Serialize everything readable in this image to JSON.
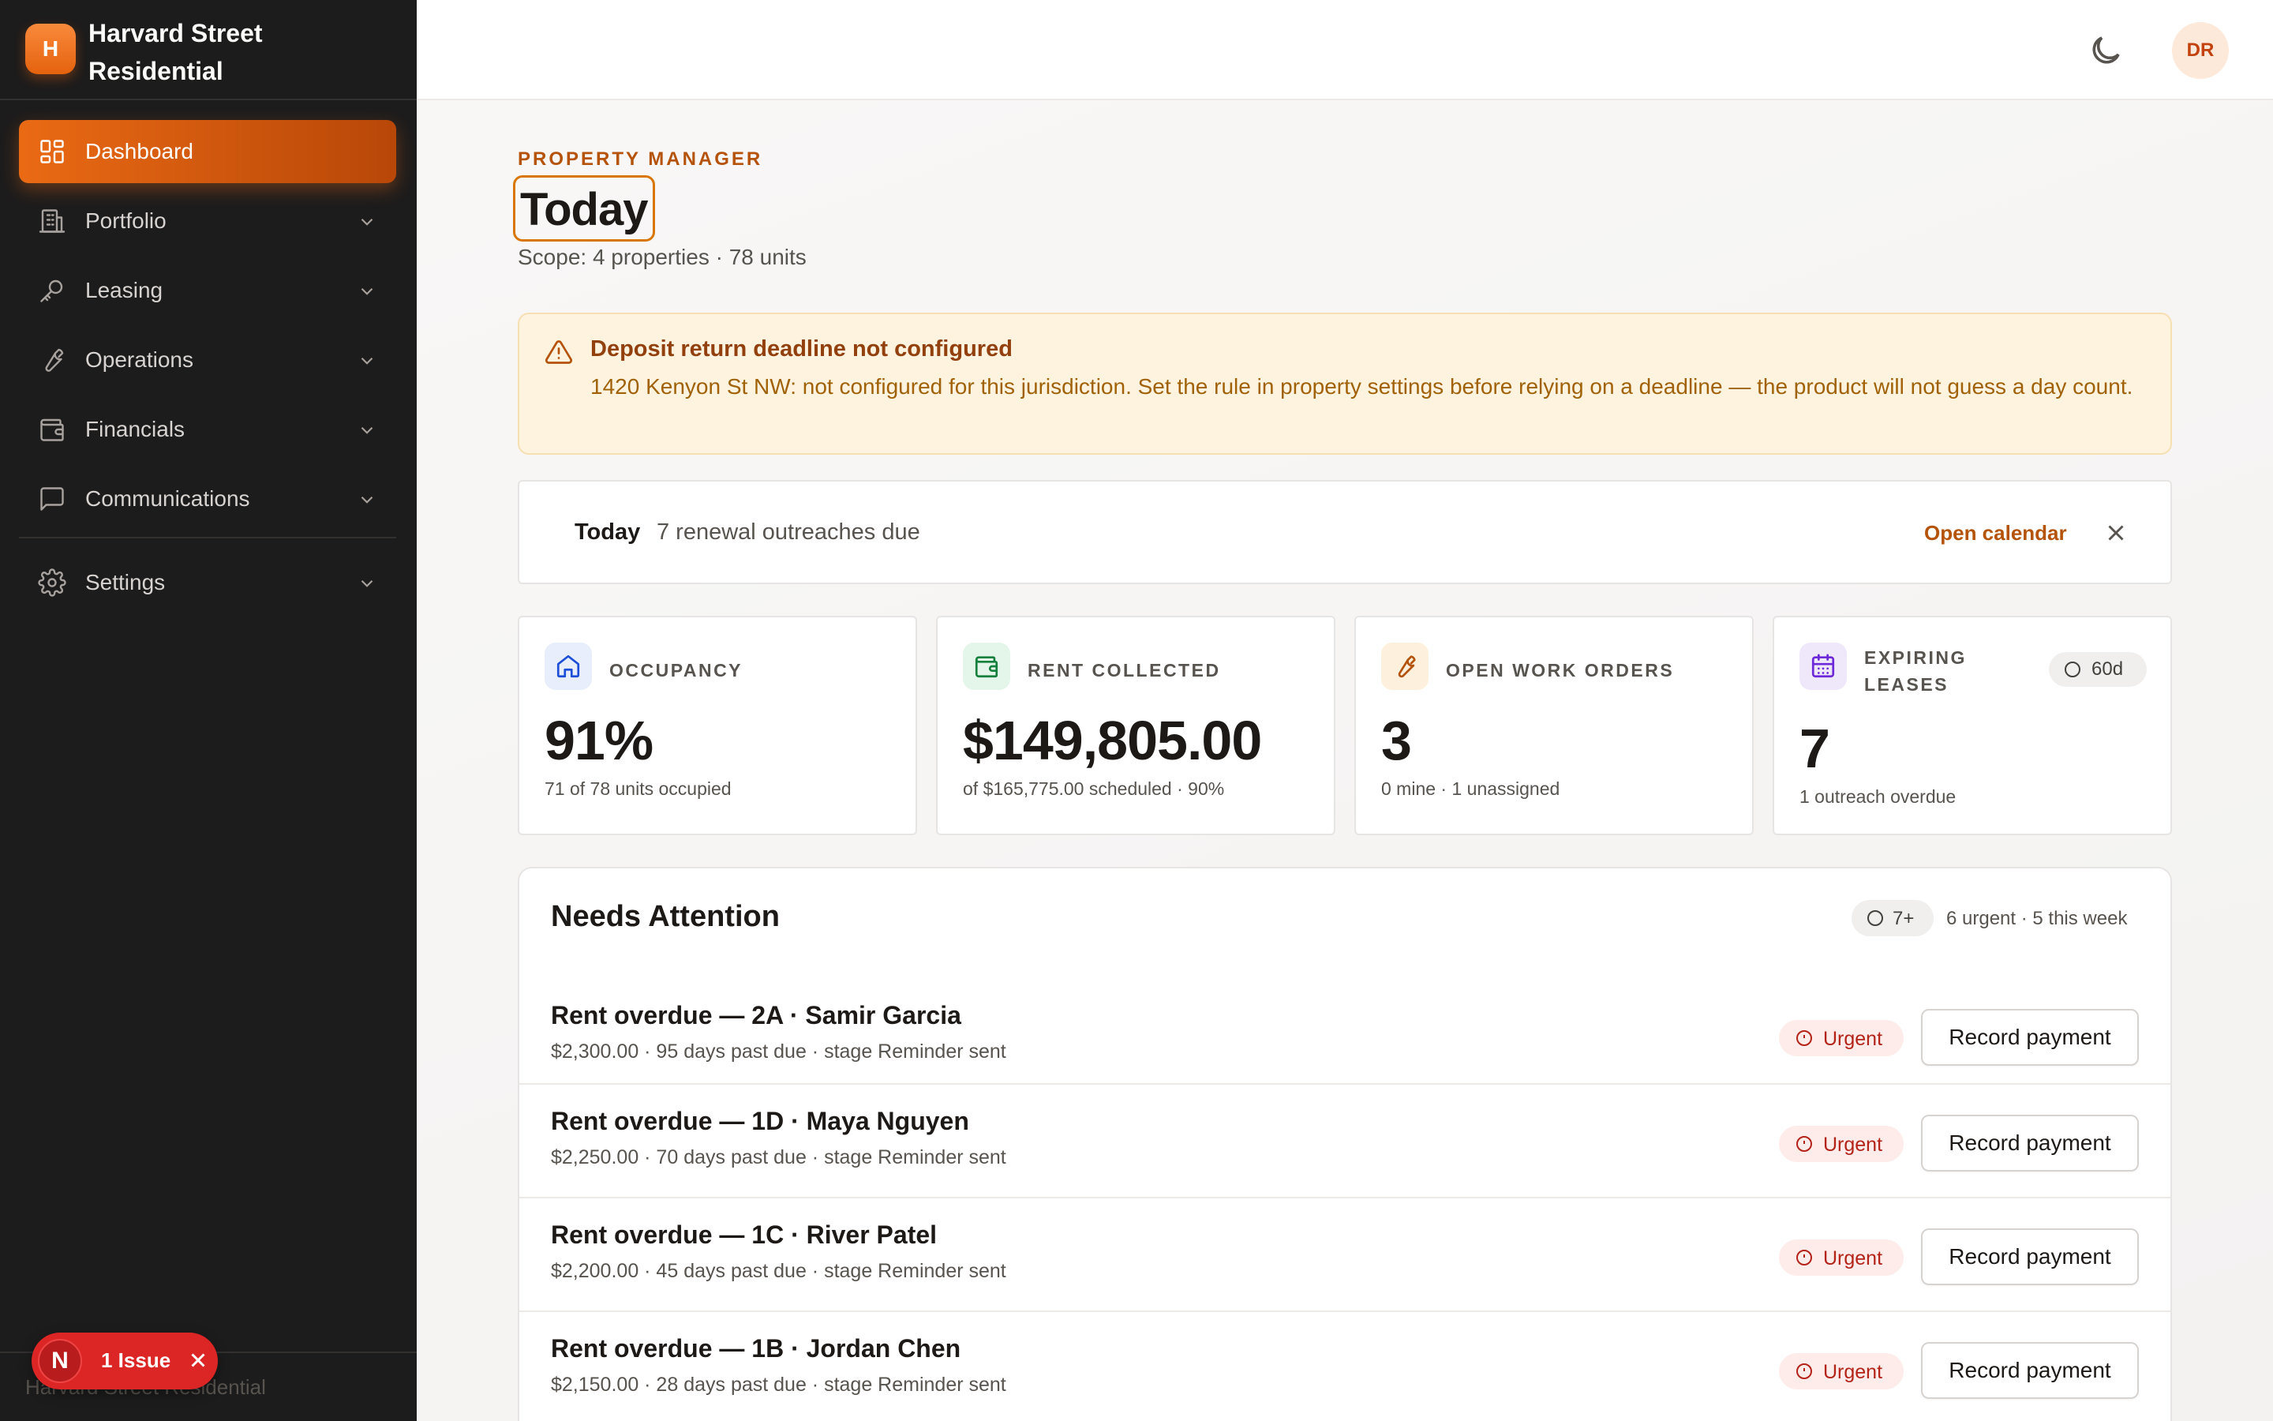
{
  "brand": {
    "initial": "H",
    "name": "Harvard Street Residential"
  },
  "sidebar": {
    "items": [
      {
        "label": "Dashboard",
        "icon": "dashboard-grid-icon",
        "active": true
      },
      {
        "label": "Portfolio",
        "icon": "building-icon"
      },
      {
        "label": "Leasing",
        "icon": "key-icon"
      },
      {
        "label": "Operations",
        "icon": "wrench-icon"
      },
      {
        "label": "Financials",
        "icon": "wallet-icon"
      },
      {
        "label": "Communications",
        "icon": "message-icon"
      },
      {
        "label": "Settings",
        "icon": "gear-icon"
      }
    ],
    "footer_text": "Harvard Street Residential"
  },
  "issue_pill": {
    "initial": "N",
    "label": "1 Issue"
  },
  "topbar": {
    "avatar_initials": "DR",
    "theme_icon": "moon-icon"
  },
  "header": {
    "eyebrow": "PROPERTY MANAGER",
    "title": "Today",
    "scope": "Scope: 4 properties · 78 units"
  },
  "alert": {
    "title": "Deposit return deadline not configured",
    "body": "1420 Kenyon St NW: not configured for this jurisdiction. Set the rule in property settings before relying on a deadline — the product will not guess a day count."
  },
  "today_bar": {
    "label": "Today",
    "text": "7 renewal outreaches due",
    "action": "Open calendar"
  },
  "stats": [
    {
      "label": "OCCUPANCY",
      "value": "91%",
      "sub": "71 of 78 units occupied",
      "icon": "home-icon",
      "color": "#1d4ed8",
      "bg": "#e8eefc"
    },
    {
      "label": "RENT COLLECTED",
      "value": "$149,805.00",
      "sub": "of $165,775.00 scheduled · 90%",
      "icon": "wallet-icon",
      "color": "#15803d",
      "bg": "#e4f5ea"
    },
    {
      "label": "OPEN WORK ORDERS",
      "value": "3",
      "sub": "0 mine · 1 unassigned",
      "icon": "wrench-icon",
      "color": "#b45309",
      "bg": "#fdf1de"
    },
    {
      "label": "EXPIRING LEASES",
      "value": "7",
      "sub": "1 outreach overdue",
      "icon": "calendar-icon",
      "color": "#6d28d9",
      "bg": "#efe8fb",
      "badge": "60d"
    }
  ],
  "attention": {
    "title": "Needs Attention",
    "badge": "7+",
    "summary": "6 urgent · 5 this week",
    "rows": [
      {
        "title": "Rent overdue — 2A · Samir Garcia",
        "sub": "$2,300.00 · 95 days past due · stage Reminder sent",
        "status": "Urgent",
        "action": "Record payment"
      },
      {
        "title": "Rent overdue — 1D · Maya Nguyen",
        "sub": "$2,250.00 · 70 days past due · stage Reminder sent",
        "status": "Urgent",
        "action": "Record payment"
      },
      {
        "title": "Rent overdue — 1C · River Patel",
        "sub": "$2,200.00 · 45 days past due · stage Reminder sent",
        "status": "Urgent",
        "action": "Record payment"
      },
      {
        "title": "Rent overdue — 1B · Jordan Chen",
        "sub": "$2,150.00 · 28 days past due · stage Reminder sent",
        "status": "Urgent",
        "action": "Record payment"
      }
    ]
  },
  "colors": {
    "accent": "#ea6a14",
    "sidebar_bg": "#1d1c1c",
    "urgent": "#b42318",
    "warning_bg": "#fdf3df"
  }
}
